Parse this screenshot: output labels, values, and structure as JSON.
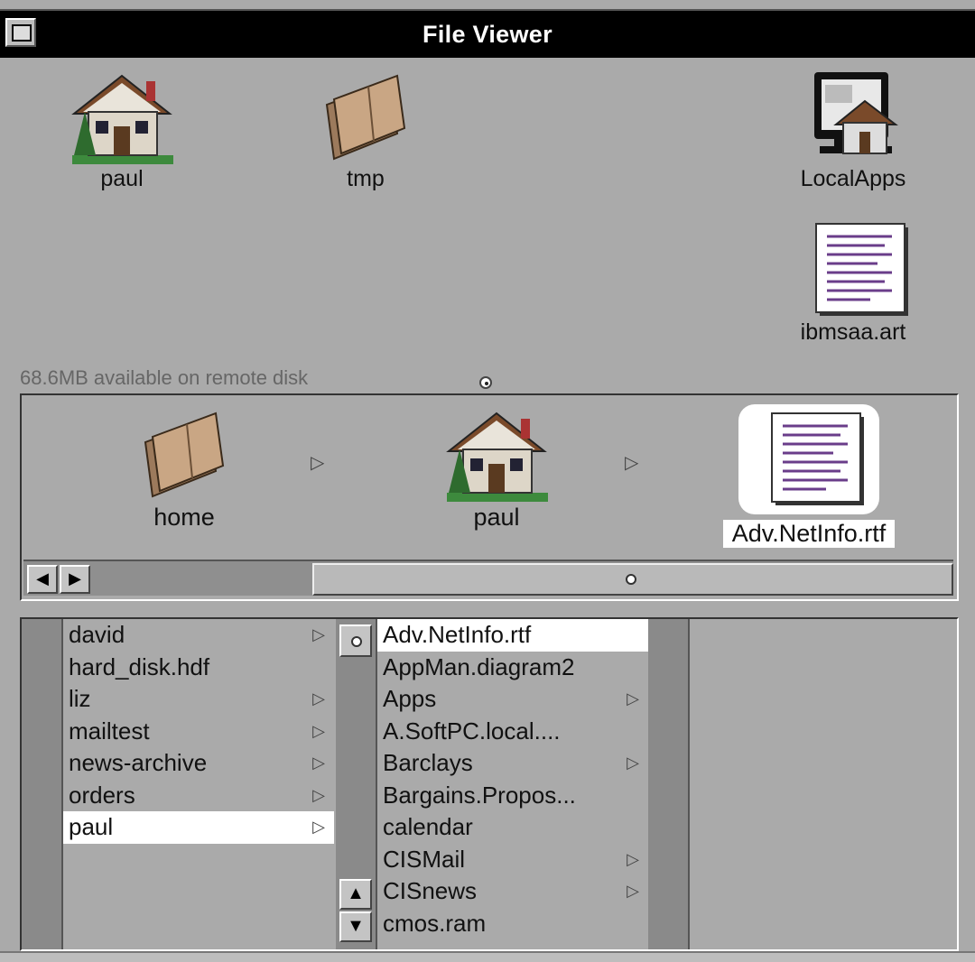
{
  "window": {
    "title": "File Viewer"
  },
  "shelf": {
    "items": [
      {
        "label": "paul",
        "icon": "house-icon"
      },
      {
        "label": "tmp",
        "icon": "folder-icon"
      },
      {
        "label": "LocalApps",
        "icon": "computer-house-icon"
      },
      {
        "label": "ibmsaa.art",
        "icon": "document-icon"
      }
    ]
  },
  "status": {
    "disk_space": "68.6MB available on remote disk"
  },
  "path": {
    "items": [
      {
        "label": "home",
        "icon": "folder-icon"
      },
      {
        "label": "paul",
        "icon": "house-icon"
      },
      {
        "label": "Adv.NetInfo.rtf",
        "icon": "document-icon",
        "selected": true
      }
    ],
    "separator": "▷"
  },
  "browser": {
    "column1": {
      "items": [
        {
          "label": "david",
          "has_children": true
        },
        {
          "label": "hard_disk.hdf",
          "has_children": false
        },
        {
          "label": "liz",
          "has_children": true
        },
        {
          "label": "mailtest",
          "has_children": true
        },
        {
          "label": "news-archive",
          "has_children": true
        },
        {
          "label": "orders",
          "has_children": true
        },
        {
          "label": "paul",
          "has_children": true,
          "selected": true
        }
      ]
    },
    "column2": {
      "items": [
        {
          "label": "Adv.NetInfo.rtf",
          "has_children": false,
          "selected": true
        },
        {
          "label": "AppMan.diagram2",
          "has_children": false
        },
        {
          "label": "Apps",
          "has_children": true
        },
        {
          "label": "A.SoftPC.local....",
          "has_children": false
        },
        {
          "label": "Barclays",
          "has_children": true
        },
        {
          "label": "Bargains.Propos...",
          "has_children": false
        },
        {
          "label": "calendar",
          "has_children": false
        },
        {
          "label": "CISMail",
          "has_children": true
        },
        {
          "label": "CISnews",
          "has_children": true
        },
        {
          "label": "cmos.ram",
          "has_children": false
        }
      ]
    }
  },
  "arrow_glyph": "▷",
  "scroll_glyphs": {
    "left": "◀",
    "right": "▶",
    "up": "▲",
    "down": "▼"
  }
}
